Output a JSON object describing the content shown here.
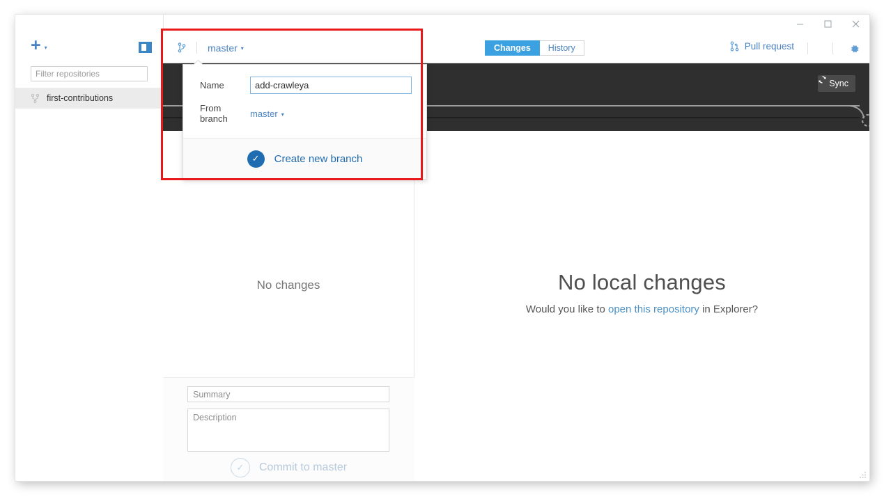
{
  "window": {
    "controls": {
      "minimize": "–",
      "maximize": "□",
      "close": "✕"
    }
  },
  "sidebar": {
    "add_repo": {
      "icon": "plus-icon",
      "label": "+",
      "caret": "▾"
    },
    "toggle_icon": "sidebar-toggle-icon",
    "filter": {
      "placeholder": "Filter repositories",
      "value": ""
    },
    "repositories": [
      {
        "name": "first-contributions",
        "icon": "git-branch-icon",
        "selected": true
      }
    ]
  },
  "topbar": {
    "branch_button": {
      "icon": "git-branch-icon",
      "label": "master",
      "caret": "▾"
    },
    "tabs": [
      {
        "label": "Changes",
        "active": true
      },
      {
        "label": "History",
        "active": false
      }
    ],
    "pull_request": {
      "icon": "pull-request-icon",
      "label": "Pull request"
    },
    "settings_icon": "gear-icon"
  },
  "graph": {
    "sync_button": {
      "icon": "sync-icon",
      "label": "Sync"
    }
  },
  "changes_panel": {
    "empty_text": "No changes",
    "summary": {
      "placeholder": "Summary",
      "value": ""
    },
    "description": {
      "placeholder": "Description",
      "value": ""
    },
    "commit_button": {
      "label": "Commit to master",
      "icon": "check-circle-icon",
      "enabled": false
    }
  },
  "right_pane": {
    "title": "No local changes",
    "subtitle_before": "Would you like to ",
    "subtitle_link": "open this repository",
    "subtitle_after": " in Explorer?"
  },
  "popover": {
    "name_label": "Name",
    "name_value": "add-crawleya",
    "from_branch_label": "From branch",
    "from_branch_value": "master",
    "from_branch_caret": "▾",
    "create_button": {
      "label": "Create new branch",
      "icon": "check-circle-icon"
    }
  },
  "colors": {
    "accent_blue": "#4a83c3",
    "tab_active_blue": "#3ba1e0",
    "popover_button_blue": "#1f6cb0",
    "graph_dark": "#2f2f2f",
    "annotation_red": "#e8181b",
    "selected_row": "#ebebeb"
  }
}
